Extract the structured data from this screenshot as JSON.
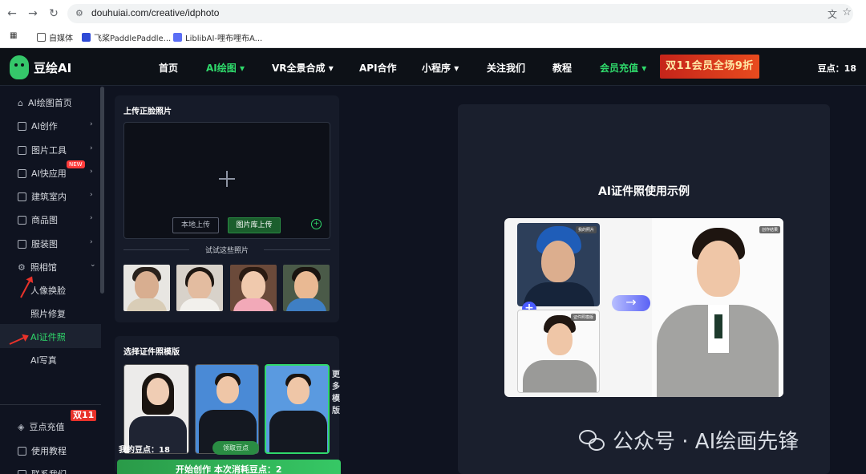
{
  "browser": {
    "url": "douhuiai.com/creative/idphoto",
    "bookmarks": [
      "自媒体",
      "飞桨PaddlePaddle...",
      "LiblibAI-哩布哩布A..."
    ]
  },
  "header": {
    "logo": "豆绘AI",
    "nav": [
      {
        "label": "首页",
        "green": false
      },
      {
        "label": "AI绘图",
        "green": true,
        "dropdown": true
      },
      {
        "label": "VR全景合成",
        "green": false,
        "dropdown": true
      },
      {
        "label": "API合作",
        "green": false
      },
      {
        "label": "小程序",
        "green": false,
        "dropdown": true
      },
      {
        "label": "关注我们",
        "green": false
      },
      {
        "label": "教程",
        "green": false
      },
      {
        "label": "会员充值",
        "green": true,
        "dropdown": true
      }
    ],
    "promo": "双11会员全场9折",
    "points": "豆点：18"
  },
  "sidebar": {
    "items": [
      "AI绘图首页",
      "AI创作",
      "图片工具",
      "AI快应用",
      "建筑室内",
      "商品图",
      "服装图",
      "照相馆"
    ],
    "new_badge": "NEW",
    "sub_items": [
      "人像换脸",
      "照片修复",
      "AI证件照",
      "AI写真"
    ],
    "bottom_items": [
      "豆点充值",
      "使用教程",
      "联系我们"
    ],
    "double11": "双11"
  },
  "upload": {
    "title": "上传正脸照片",
    "local_btn": "本地上传",
    "library_btn": "图片库上传",
    "try_label": "试试这些照片"
  },
  "template": {
    "title": "选择证件照模版",
    "more": "更多模版",
    "my_points": "我的豆点：18",
    "get_points": "领取豆点"
  },
  "start_btn": "开始创作 本次消耗豆点：2",
  "example": {
    "title": "AI证件照使用示例",
    "tag_my": "我的照片",
    "tag_tpl": "证件照模版",
    "tag_result": "创作结果"
  },
  "watermark": "公众号 · AI绘画先锋",
  "colors": {
    "accent": "#2fd96b",
    "bg": "#0f1320",
    "panel": "#161b29"
  }
}
